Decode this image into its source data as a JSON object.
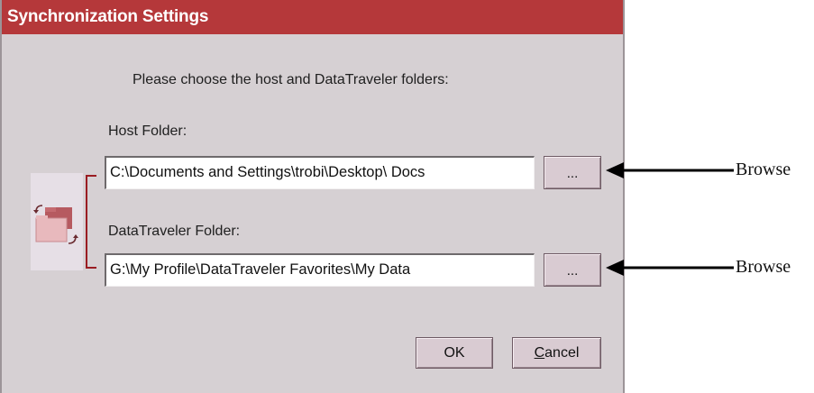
{
  "dialog": {
    "title": "Synchronization Settings",
    "instruction": "Please choose the host and DataTraveler folders:",
    "host_folder": {
      "label": "Host Folder:",
      "value": "C:\\Documents and Settings\\trobi\\Desktop\\ Docs",
      "browse_label": "..."
    },
    "datatraveler_folder": {
      "label": "DataTraveler Folder:",
      "value": "G:\\My Profile\\DataTraveler Favorites\\My Data",
      "browse_label": "..."
    },
    "ok_label": "OK",
    "cancel_label_first": "C",
    "cancel_label_rest": "ancel"
  },
  "annotations": {
    "browse_1": "Browse",
    "browse_2": "Browse"
  },
  "icons": {
    "sync": "sync-folders-icon",
    "arrow": "arrow-left-icon"
  },
  "colors": {
    "title_bar": "#b5383a",
    "dialog_bg": "#d6d0d3",
    "bracket": "#9a1c22",
    "button_bg": "#d9cbd2"
  }
}
